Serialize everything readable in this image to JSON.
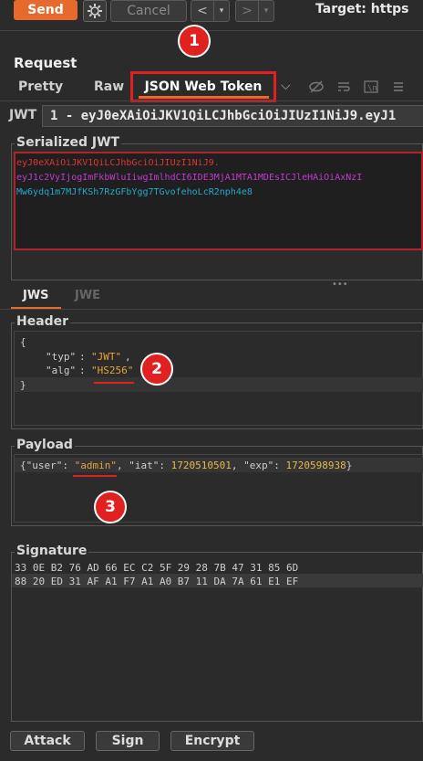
{
  "toolbar": {
    "send_label": "Send",
    "cancel_label": "Cancel",
    "back_arrow": "<",
    "forward_arrow": ">",
    "dropdown_glyph": "▾",
    "target_label": "Target: https"
  },
  "request": {
    "title": "Request",
    "tabs": [
      "Pretty",
      "Raw",
      "JSON Web Token"
    ],
    "tab_dropdown": "⌵",
    "jwt_label": "JWT",
    "jwt_selected": "1 - eyJ0eXAiOiJKV1QiLCJhbGciOiJIUzI1NiJ9.eyJ1"
  },
  "serialized": {
    "label": "Serialized JWT",
    "header_part": "eyJ0eXAiOiJKV1QiLCJhbGciOiJIUzI1NiJ9.",
    "payload_part": "eyJ1c2VyIjogImFkbWluIiwgImlhdCI6IDE3MjA1MTA1MDEsICJleHAiOiAxNzI",
    "signature_part": "Mw6ydq1m7MJfKSh7RzGFbYgg7TGvofehoLcR2nph4e8",
    "colors": {
      "header": "#e0343a",
      "payload": "#c23ad1",
      "signature": "#22aac8"
    }
  },
  "jws_tabs": [
    "JWS",
    "JWE"
  ],
  "header": {
    "label": "Header",
    "open": "{",
    "typ_key": "\"typ\"",
    "typ_val": "\"JWT\"",
    "alg_key": "\"alg\"",
    "alg_val": "\"HS256\"",
    "close": "}"
  },
  "payload": {
    "label": "Payload",
    "user_key": "\"user\"",
    "user_val": "\"admin\"",
    "iat_key": "\"iat\"",
    "iat_val": "1720510501",
    "exp_key": "\"exp\"",
    "exp_val": "1720598938"
  },
  "signature": {
    "label": "Signature",
    "row1": "33 0E B2 76 AD 66 EC C2 5F 29 28 7B 47 31 85 6D",
    "row2": "88 20 ED 31 AF A1 F7 A1 A0 B7 11 DA 7A 61 E1 EF"
  },
  "markers": [
    "1",
    "2",
    "3"
  ],
  "actions": [
    "Attack",
    "Sign",
    "Encrypt"
  ]
}
